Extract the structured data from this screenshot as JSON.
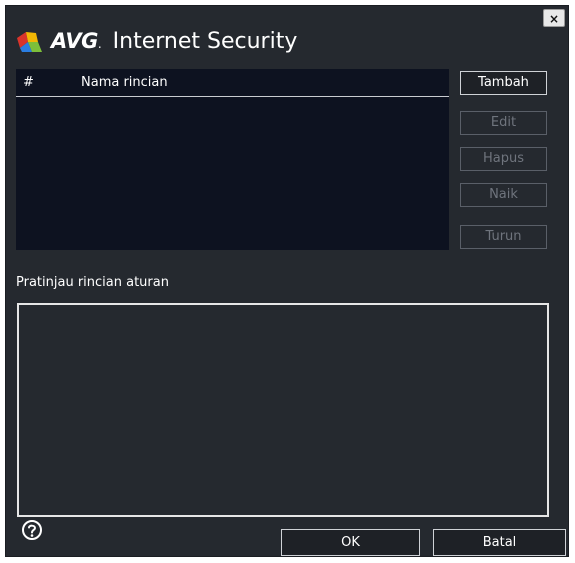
{
  "window": {
    "close_label": "×"
  },
  "brand": {
    "logo_text": "AVG",
    "dot": ".",
    "product": "Internet Security"
  },
  "list": {
    "col_hash": "#",
    "col_name": "Nama rincian",
    "rows": []
  },
  "buttons": {
    "add": "Tambah",
    "edit": "Edit",
    "delete": "Hapus",
    "up": "Naik",
    "down": "Turun"
  },
  "preview": {
    "label": "Pratinjau rincian aturan",
    "content": ""
  },
  "footer": {
    "ok": "OK",
    "cancel": "Batal",
    "help_icon": "question-circle-icon"
  },
  "colors": {
    "window_bg": "#25292f",
    "list_bg": "#0d1220",
    "disabled_text": "#6f747d",
    "logo_red": "#d9342b",
    "logo_blue": "#2a7de1",
    "logo_green": "#7dbf3a",
    "logo_yellow": "#f2b705"
  }
}
